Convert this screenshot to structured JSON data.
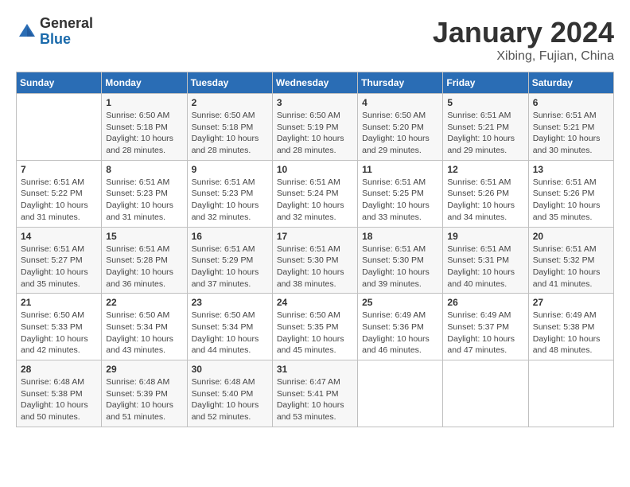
{
  "logo": {
    "general": "General",
    "blue": "Blue"
  },
  "title": "January 2024",
  "subtitle": "Xibing, Fujian, China",
  "days_of_week": [
    "Sunday",
    "Monday",
    "Tuesday",
    "Wednesday",
    "Thursday",
    "Friday",
    "Saturday"
  ],
  "weeks": [
    [
      {
        "day": "",
        "info": ""
      },
      {
        "day": "1",
        "info": "Sunrise: 6:50 AM\nSunset: 5:18 PM\nDaylight: 10 hours\nand 28 minutes."
      },
      {
        "day": "2",
        "info": "Sunrise: 6:50 AM\nSunset: 5:18 PM\nDaylight: 10 hours\nand 28 minutes."
      },
      {
        "day": "3",
        "info": "Sunrise: 6:50 AM\nSunset: 5:19 PM\nDaylight: 10 hours\nand 28 minutes."
      },
      {
        "day": "4",
        "info": "Sunrise: 6:50 AM\nSunset: 5:20 PM\nDaylight: 10 hours\nand 29 minutes."
      },
      {
        "day": "5",
        "info": "Sunrise: 6:51 AM\nSunset: 5:21 PM\nDaylight: 10 hours\nand 29 minutes."
      },
      {
        "day": "6",
        "info": "Sunrise: 6:51 AM\nSunset: 5:21 PM\nDaylight: 10 hours\nand 30 minutes."
      }
    ],
    [
      {
        "day": "7",
        "info": "Sunrise: 6:51 AM\nSunset: 5:22 PM\nDaylight: 10 hours\nand 31 minutes."
      },
      {
        "day": "8",
        "info": "Sunrise: 6:51 AM\nSunset: 5:23 PM\nDaylight: 10 hours\nand 31 minutes."
      },
      {
        "day": "9",
        "info": "Sunrise: 6:51 AM\nSunset: 5:23 PM\nDaylight: 10 hours\nand 32 minutes."
      },
      {
        "day": "10",
        "info": "Sunrise: 6:51 AM\nSunset: 5:24 PM\nDaylight: 10 hours\nand 32 minutes."
      },
      {
        "day": "11",
        "info": "Sunrise: 6:51 AM\nSunset: 5:25 PM\nDaylight: 10 hours\nand 33 minutes."
      },
      {
        "day": "12",
        "info": "Sunrise: 6:51 AM\nSunset: 5:26 PM\nDaylight: 10 hours\nand 34 minutes."
      },
      {
        "day": "13",
        "info": "Sunrise: 6:51 AM\nSunset: 5:26 PM\nDaylight: 10 hours\nand 35 minutes."
      }
    ],
    [
      {
        "day": "14",
        "info": "Sunrise: 6:51 AM\nSunset: 5:27 PM\nDaylight: 10 hours\nand 35 minutes."
      },
      {
        "day": "15",
        "info": "Sunrise: 6:51 AM\nSunset: 5:28 PM\nDaylight: 10 hours\nand 36 minutes."
      },
      {
        "day": "16",
        "info": "Sunrise: 6:51 AM\nSunset: 5:29 PM\nDaylight: 10 hours\nand 37 minutes."
      },
      {
        "day": "17",
        "info": "Sunrise: 6:51 AM\nSunset: 5:30 PM\nDaylight: 10 hours\nand 38 minutes."
      },
      {
        "day": "18",
        "info": "Sunrise: 6:51 AM\nSunset: 5:30 PM\nDaylight: 10 hours\nand 39 minutes."
      },
      {
        "day": "19",
        "info": "Sunrise: 6:51 AM\nSunset: 5:31 PM\nDaylight: 10 hours\nand 40 minutes."
      },
      {
        "day": "20",
        "info": "Sunrise: 6:51 AM\nSunset: 5:32 PM\nDaylight: 10 hours\nand 41 minutes."
      }
    ],
    [
      {
        "day": "21",
        "info": "Sunrise: 6:50 AM\nSunset: 5:33 PM\nDaylight: 10 hours\nand 42 minutes."
      },
      {
        "day": "22",
        "info": "Sunrise: 6:50 AM\nSunset: 5:34 PM\nDaylight: 10 hours\nand 43 minutes."
      },
      {
        "day": "23",
        "info": "Sunrise: 6:50 AM\nSunset: 5:34 PM\nDaylight: 10 hours\nand 44 minutes."
      },
      {
        "day": "24",
        "info": "Sunrise: 6:50 AM\nSunset: 5:35 PM\nDaylight: 10 hours\nand 45 minutes."
      },
      {
        "day": "25",
        "info": "Sunrise: 6:49 AM\nSunset: 5:36 PM\nDaylight: 10 hours\nand 46 minutes."
      },
      {
        "day": "26",
        "info": "Sunrise: 6:49 AM\nSunset: 5:37 PM\nDaylight: 10 hours\nand 47 minutes."
      },
      {
        "day": "27",
        "info": "Sunrise: 6:49 AM\nSunset: 5:38 PM\nDaylight: 10 hours\nand 48 minutes."
      }
    ],
    [
      {
        "day": "28",
        "info": "Sunrise: 6:48 AM\nSunset: 5:38 PM\nDaylight: 10 hours\nand 50 minutes."
      },
      {
        "day": "29",
        "info": "Sunrise: 6:48 AM\nSunset: 5:39 PM\nDaylight: 10 hours\nand 51 minutes."
      },
      {
        "day": "30",
        "info": "Sunrise: 6:48 AM\nSunset: 5:40 PM\nDaylight: 10 hours\nand 52 minutes."
      },
      {
        "day": "31",
        "info": "Sunrise: 6:47 AM\nSunset: 5:41 PM\nDaylight: 10 hours\nand 53 minutes."
      },
      {
        "day": "",
        "info": ""
      },
      {
        "day": "",
        "info": ""
      },
      {
        "day": "",
        "info": ""
      }
    ]
  ]
}
